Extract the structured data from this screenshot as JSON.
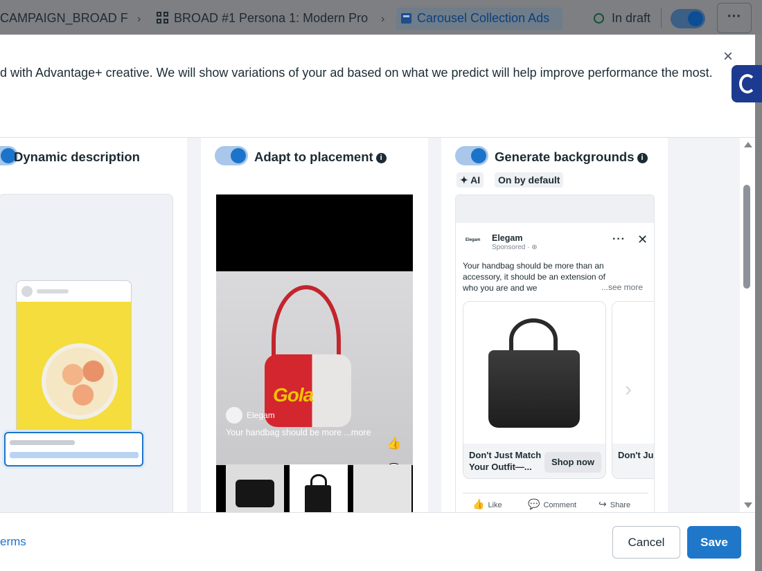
{
  "topbar": {
    "crumb1": "CAMPAIGN_BROAD F",
    "crumb2": "BROAD #1 Persona 1: Modern Pro",
    "crumb3": "Carousel Collection Ads",
    "status": "In draft",
    "more": "···"
  },
  "modal": {
    "description": "d with Advantage+ creative. We will show variations of your ad based on what we predict will help improve performance the most.",
    "close": "×"
  },
  "options": [
    {
      "title": "Dynamic description",
      "enabled": true
    },
    {
      "title": "Adapt to placement",
      "enabled": true
    },
    {
      "title": "Generate backgrounds",
      "enabled": true,
      "badges": [
        "AI",
        "On by default"
      ]
    }
  ],
  "preview_adapt": {
    "brand": "Elegam",
    "text": "Your handbag should be more      ...more",
    "logo_text": "Gola"
  },
  "preview_backgrounds": {
    "logo_text": "Elegam",
    "brand": "Elegam",
    "sponsored": "Sponsored · ⊕",
    "body": "Your handbag should be more than an accessory, it should be an extension of who you are and we",
    "see_more": "...see more",
    "card1_title": "Don't Just Match Your Outfit—...",
    "card1_cta": "Shop now",
    "card2_title": "Don't Ju Your Ou",
    "actions": [
      "Like",
      "Comment",
      "Share"
    ]
  },
  "footer": {
    "terms": "erms",
    "cancel": "Cancel",
    "save": "Save"
  },
  "colors": {
    "accent": "#1f77c9",
    "toggle_track": "#a8c7ea"
  }
}
